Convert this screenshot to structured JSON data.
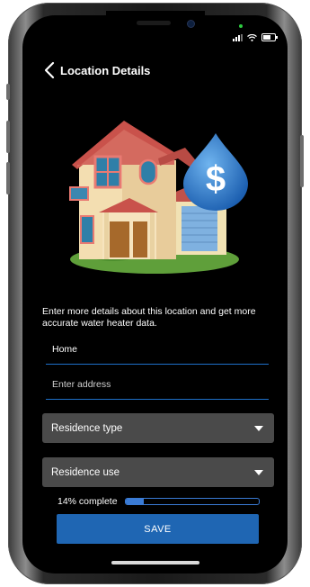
{
  "status_bar": {
    "signal_icon": "signal-icon",
    "wifi_icon": "wifi-icon",
    "battery_icon": "battery-icon"
  },
  "header": {
    "back_icon": "chevron-left-icon",
    "title": "Location Details"
  },
  "illustration": {
    "house": "house-illustration",
    "drop_icon": "water-drop-dollar-icon",
    "dollar_symbol": "$"
  },
  "description": "Enter more details about this location and get more accurate water heater data.",
  "form": {
    "name_value": "Home",
    "address_placeholder": "Enter address",
    "residence_type_label": "Residence type",
    "residence_use_label": "Residence use"
  },
  "progress": {
    "label": "14% complete",
    "value": 0.14
  },
  "save_label": "SAVE",
  "colors": {
    "accent": "#1f66b3",
    "field_underline": "#1e6fc8",
    "select_bg": "#4a4a4a",
    "background": "#000000"
  }
}
